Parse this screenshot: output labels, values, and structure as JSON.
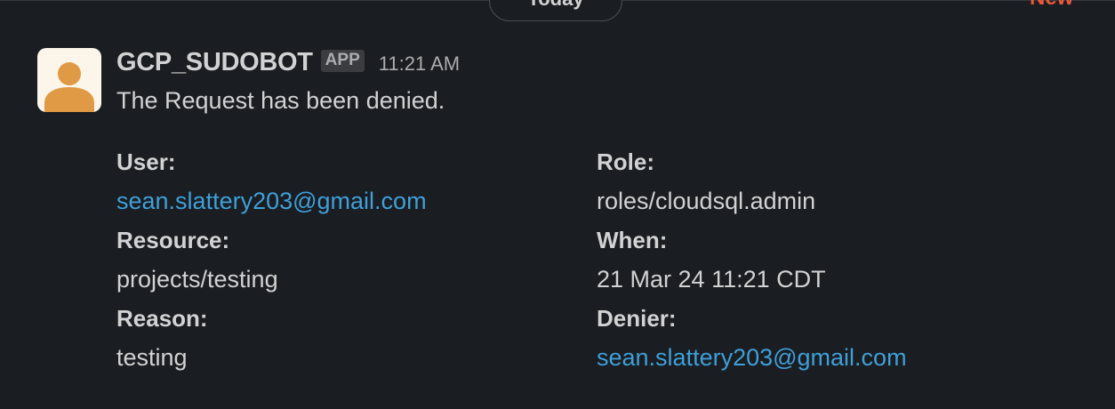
{
  "day_divider": {
    "label": "Today",
    "new_label": "New"
  },
  "message": {
    "avatar_icon": "user-avatar-icon",
    "sender": "GCP_SUDOBOT",
    "badge": "APP",
    "time": "11:21 AM",
    "text": "The Request has been denied.",
    "fields": {
      "user": {
        "label": "User:",
        "value": "sean.slattery203@gmail.com"
      },
      "role": {
        "label": "Role:",
        "value": "roles/cloudsql.admin"
      },
      "resource": {
        "label": "Resource:",
        "value": "projects/testing"
      },
      "when": {
        "label": "When:",
        "value": "21 Mar 24 11:21 CDT"
      },
      "reason": {
        "label": "Reason:",
        "value": "testing"
      },
      "denier": {
        "label": "Denier:",
        "value": "sean.slattery203@gmail.com"
      }
    }
  },
  "colors": {
    "background": "#1a1d21",
    "text": "#d1d2d3",
    "muted": "#abacae",
    "link": "#3f9fd8",
    "new_marker": "#e8593a",
    "avatar_bg": "#fcf5ea",
    "avatar_figure": "#e09a45"
  }
}
